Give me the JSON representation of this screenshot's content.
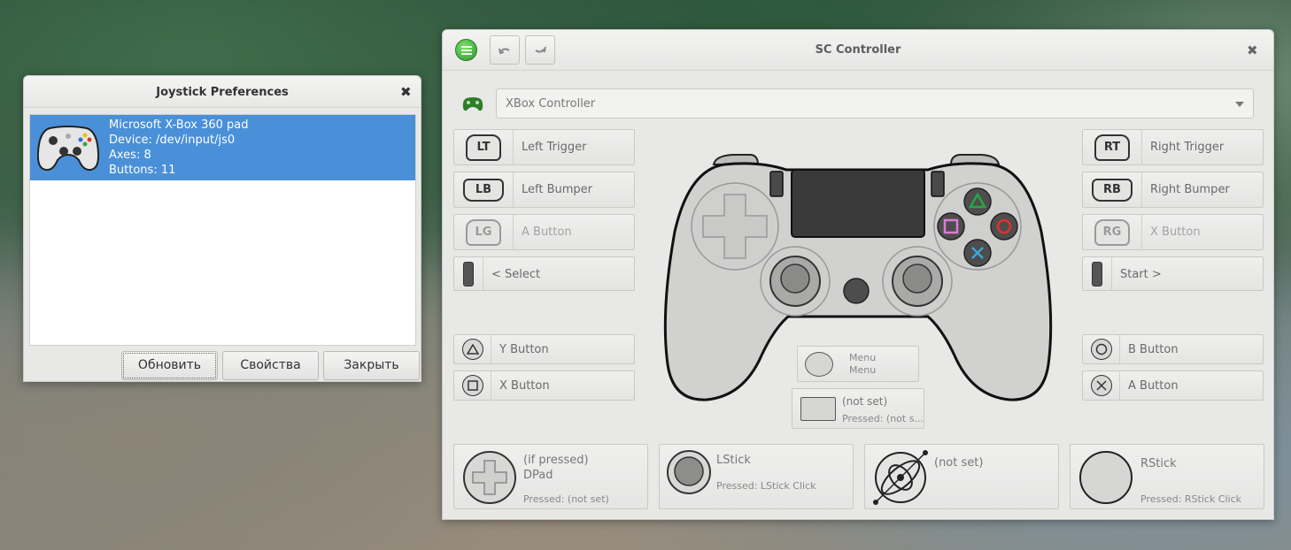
{
  "sc": {
    "title": "SC Controller",
    "undo_icon": "undo-icon",
    "redo_icon": "redo-icon",
    "close": "✖",
    "profile": "XBox Controller",
    "left": {
      "lt": {
        "badge": "LT",
        "label": "Left Trigger"
      },
      "lb": {
        "badge": "LB",
        "label": "Left Bumper"
      },
      "lg": {
        "badge": "LG",
        "label": "A Button"
      },
      "select": {
        "label": "< Select"
      },
      "y": {
        "label": "Y Button"
      },
      "x": {
        "label": "X Button"
      }
    },
    "right": {
      "rt": {
        "badge": "RT",
        "label": "Right Trigger"
      },
      "rb": {
        "badge": "RB",
        "label": "Right Bumper"
      },
      "rg": {
        "badge": "RG",
        "label": "X Button"
      },
      "start": {
        "label": "Start >"
      },
      "b": {
        "label": "B Button"
      },
      "a": {
        "label": "A Button"
      }
    },
    "center": {
      "menu1": "Menu",
      "menu2": "Menu",
      "pad_title": "(not set)",
      "pad_pressed": "Pressed: (not s..."
    },
    "bottom": {
      "dpad_line1": "(if pressed)",
      "dpad_line2": "DPad",
      "dpad_pressed": "Pressed: (not set)",
      "lstick_title": "LStick",
      "lstick_pressed": "Pressed: LStick Click",
      "gyro_title": "(not set)",
      "rstick_title": "RStick",
      "rstick_pressed": "Pressed: RStick Click"
    }
  },
  "jp": {
    "title": "Joystick Preferences",
    "close": "✖",
    "device": {
      "name": "Microsoft X-Box 360 pad",
      "path": "Device: /dev/input/js0",
      "axes": "Axes: 8",
      "buttons": "Buttons: 11"
    },
    "buttons": {
      "refresh": "Обновить",
      "properties": "Свойства",
      "close": "Закрыть"
    }
  }
}
